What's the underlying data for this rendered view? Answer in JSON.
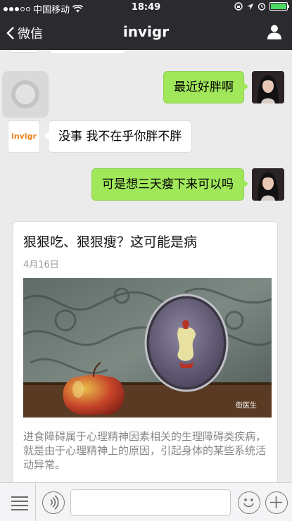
{
  "status_bar": {
    "carrier": "中国移动",
    "time": "18:49"
  },
  "nav": {
    "back_label": "微信",
    "title": "invigr"
  },
  "contact_logo_text": "invigr",
  "messages": [
    {
      "sender": "me",
      "text": "最近好胖啊"
    },
    {
      "sender": "contact",
      "text": "没事 我不在乎你胖不胖"
    },
    {
      "sender": "me",
      "text": "可是想三天瘦下来可以吗"
    }
  ],
  "article_card": {
    "title": "狠狠吃、狠狠瘦？这可能是病",
    "date": "4月16日",
    "image_watermark": "街医生",
    "description": "进食障碍属于心理精神因素相关的生理障碍类疾病，就是由于心理精神上的原因，引起身体的某些系统活动异常。"
  },
  "colors": {
    "nav_bg": "#2b2b2f",
    "chat_bg": "#ebebeb",
    "my_bubble": "#a0e75a",
    "their_bubble": "#ffffff",
    "logo_orange": "#f0821e"
  },
  "icons": [
    "back-chevron-icon",
    "person-icon",
    "menu-list-icon",
    "voice-icon",
    "emoji-icon",
    "plus-icon"
  ]
}
